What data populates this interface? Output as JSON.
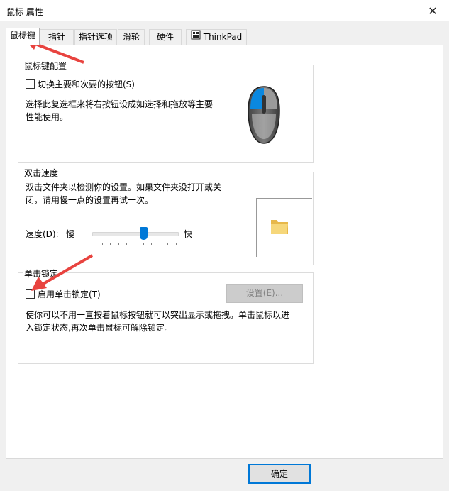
{
  "window": {
    "title": "鼠标 属性"
  },
  "tabs": [
    {
      "label": "鼠标键"
    },
    {
      "label": "指针"
    },
    {
      "label": "指针选项"
    },
    {
      "label": "滑轮"
    },
    {
      "label": "硬件"
    },
    {
      "label": "ThinkPad"
    }
  ],
  "button_config": {
    "title": "鼠标键配置",
    "swap_checkbox_label": "切换主要和次要的按钮(S)",
    "swap_checked": false,
    "description_line1": "选择此复选框来将右按钮设成如选择和拖放等主要",
    "description_line2": "性能使用。"
  },
  "double_click": {
    "title": "双击速度",
    "description_line1": "双击文件夹以检测你的设置。如果文件夹没打开或关",
    "description_line2": "闭，请用慢一点的设置再试一次。",
    "speed_label": "速度(D):",
    "slow_label": "慢",
    "fast_label": "快",
    "speed_fraction": 0.6
  },
  "click_lock": {
    "title": "单击锁定",
    "checkbox_label": "启用单击锁定(T)",
    "checked": false,
    "settings_button": "设置(E)...",
    "description_line1": "使你可以不用一直按着鼠标按钮就可以突出显示或拖拽。单击鼠标以进",
    "description_line2": "入锁定状态,再次单击鼠标可解除锁定。"
  },
  "footer": {
    "ok_button": "确定"
  },
  "colors": {
    "accent": "#0078d7",
    "annotation_arrow": "#e8433f"
  }
}
